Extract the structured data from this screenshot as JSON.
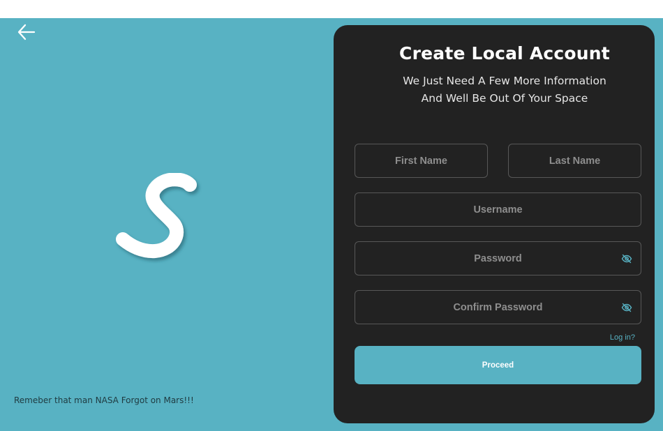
{
  "colors": {
    "accent": "#58b2c3",
    "card_background": "#222222",
    "field_border": "#585858",
    "placeholder": "#8e8e8e"
  },
  "header": {
    "back_icon": "arrow-left-icon"
  },
  "brand": {
    "logo_icon": "s-logo-icon"
  },
  "footer": {
    "quote": "Remeber that man NASA Forgot on Mars!!!"
  },
  "form": {
    "title": "Create Local Account",
    "subtitle_line1": "We Just Need A Few More Information",
    "subtitle_line2": "And Well Be Out Of Your Space",
    "first_name": {
      "placeholder": "First Name",
      "value": ""
    },
    "last_name": {
      "placeholder": "Last Name",
      "value": ""
    },
    "username": {
      "placeholder": "Username",
      "value": ""
    },
    "password": {
      "placeholder": "Password",
      "value": "",
      "icon": "eye-slash-icon"
    },
    "confirm_password": {
      "placeholder": "Confirm Password",
      "value": "",
      "icon": "eye-slash-icon"
    },
    "login_link": "Log in?",
    "proceed_label": "Proceed"
  }
}
